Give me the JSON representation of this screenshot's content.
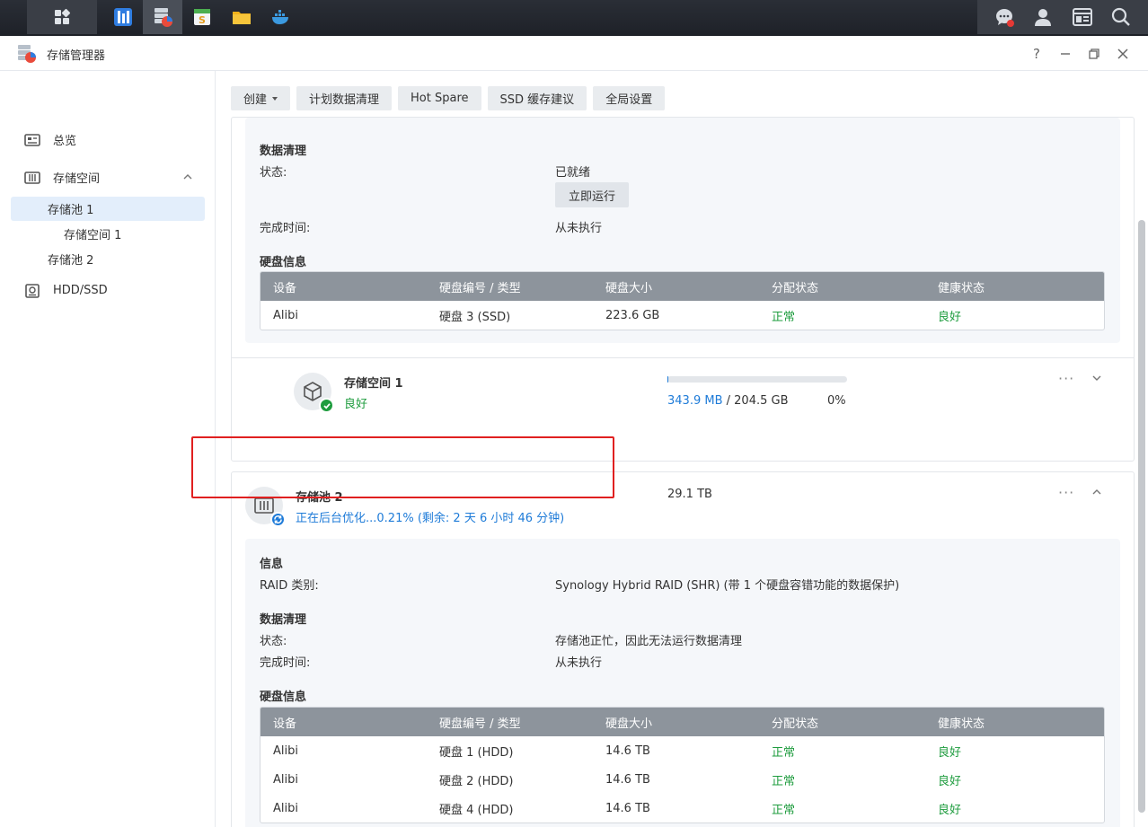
{
  "window": {
    "title": "存储管理器"
  },
  "sidebar": {
    "items": [
      {
        "label": "总览"
      },
      {
        "label": "存储空间"
      },
      {
        "label": "存储池 1"
      },
      {
        "label": "存储空间 1"
      },
      {
        "label": "存储池 2"
      },
      {
        "label": "HDD/SSD"
      }
    ]
  },
  "toolbar": {
    "create": "创建",
    "scrub": "计划数据清理",
    "hotspare": "Hot Spare",
    "ssd": "SSD 缓存建议",
    "global": "全局设置"
  },
  "pool1_detail": {
    "scrub_title": "数据清理",
    "status_label": "状态:",
    "status_value": "已就绪",
    "run_button": "立即运行",
    "finish_label": "完成时间:",
    "finish_value": "从未执行",
    "disk_title": "硬盘信息",
    "headers": [
      "设备",
      "硬盘编号 / 类型",
      "硬盘大小",
      "分配状态",
      "健康状态"
    ],
    "rows": [
      [
        "Alibi",
        "硬盘 3 (SSD)",
        "223.6 GB",
        "正常",
        "良好"
      ]
    ]
  },
  "volume1": {
    "name": "存储空间 1",
    "status": "良好",
    "used": "343.9 MB",
    "separator": "/",
    "total": "204.5 GB",
    "percent": "0%",
    "usage_fraction": 0.005
  },
  "pool2": {
    "name": "存储池 2",
    "status": "正在后台优化...0.21% (剩余: 2 天 6 小时 46 分钟)",
    "size": "29.1 TB",
    "info_title": "信息",
    "raid_label": "RAID 类别:",
    "raid_value": "Synology Hybrid RAID (SHR) (带 1 个硬盘容错功能的数据保护)",
    "scrub_title": "数据清理",
    "status_label": "状态:",
    "status_value": "存储池正忙，因此无法运行数据清理",
    "finish_label": "完成时间:",
    "finish_value": "从未执行",
    "disk_title": "硬盘信息",
    "headers": [
      "设备",
      "硬盘编号 / 类型",
      "硬盘大小",
      "分配状态",
      "健康状态"
    ],
    "rows": [
      [
        "Alibi",
        "硬盘 1 (HDD)",
        "14.6 TB",
        "正常",
        "良好"
      ],
      [
        "Alibi",
        "硬盘 2 (HDD)",
        "14.6 TB",
        "正常",
        "良好"
      ],
      [
        "Alibi",
        "硬盘 4 (HDD)",
        "14.6 TB",
        "正常",
        "良好"
      ]
    ]
  },
  "colors": {
    "accent": "#1e7bd8",
    "ok": "#1e9c3e",
    "alert": "#e02020"
  }
}
